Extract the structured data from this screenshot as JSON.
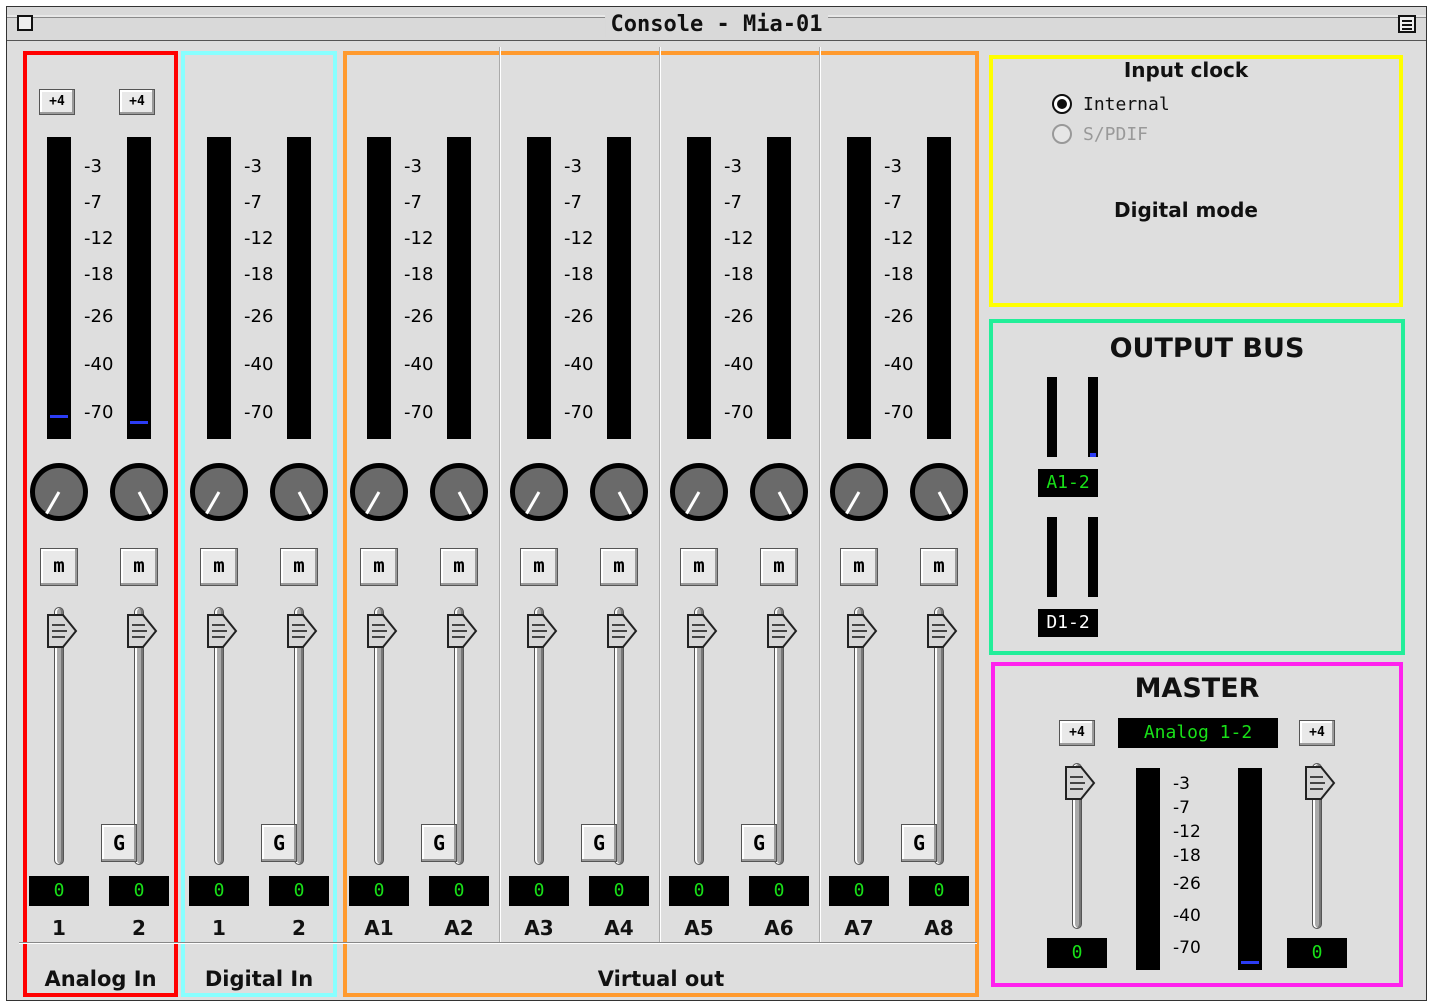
{
  "window": {
    "title": "Console - Mia-01"
  },
  "meter_scale": [
    "-3",
    "-7",
    "-12",
    "-18",
    "-26",
    "-40",
    "-70"
  ],
  "plus4_label": "+4",
  "mute_label": "m",
  "gain_label": "G",
  "channels": [
    {
      "label": "1",
      "value": "0",
      "level": 0.08
    },
    {
      "label": "2",
      "value": "0",
      "level": 0.06
    },
    {
      "label": "1",
      "value": "0",
      "level": 0
    },
    {
      "label": "2",
      "value": "0",
      "level": 0
    },
    {
      "label": "A1",
      "value": "0",
      "level": 0
    },
    {
      "label": "A2",
      "value": "0",
      "level": 0
    },
    {
      "label": "A3",
      "value": "0",
      "level": 0
    },
    {
      "label": "A4",
      "value": "0",
      "level": 0
    },
    {
      "label": "A5",
      "value": "0",
      "level": 0
    },
    {
      "label": "A6",
      "value": "0",
      "level": 0
    },
    {
      "label": "A7",
      "value": "0",
      "level": 0
    },
    {
      "label": "A8",
      "value": "0",
      "level": 0
    }
  ],
  "groups": [
    {
      "label": "Analog In",
      "color": "#ff0000"
    },
    {
      "label": "Digital In",
      "color": "#88ffff"
    },
    {
      "label": "Virtual out",
      "color": "#ff9a2e"
    }
  ],
  "input_clock": {
    "title": "Input clock",
    "options": [
      {
        "label": "Internal",
        "selected": true,
        "enabled": true
      },
      {
        "label": "S/PDIF",
        "selected": false,
        "enabled": false
      }
    ],
    "digital_mode_title": "Digital mode",
    "color": "#ffff00"
  },
  "output_bus": {
    "title": "OUTPUT BUS",
    "color": "#22ee99",
    "buses": [
      {
        "label": "A1-2",
        "label_color": "#18e018",
        "level": 0.05
      },
      {
        "label": "D1-2",
        "label_color": "#ffffff",
        "level": 0
      }
    ]
  },
  "master": {
    "title": "MASTER",
    "color": "#ff22ee",
    "source": "Analog 1-2",
    "left_value": "0",
    "right_value": "0",
    "left_level": 0,
    "right_level": 0.04
  }
}
